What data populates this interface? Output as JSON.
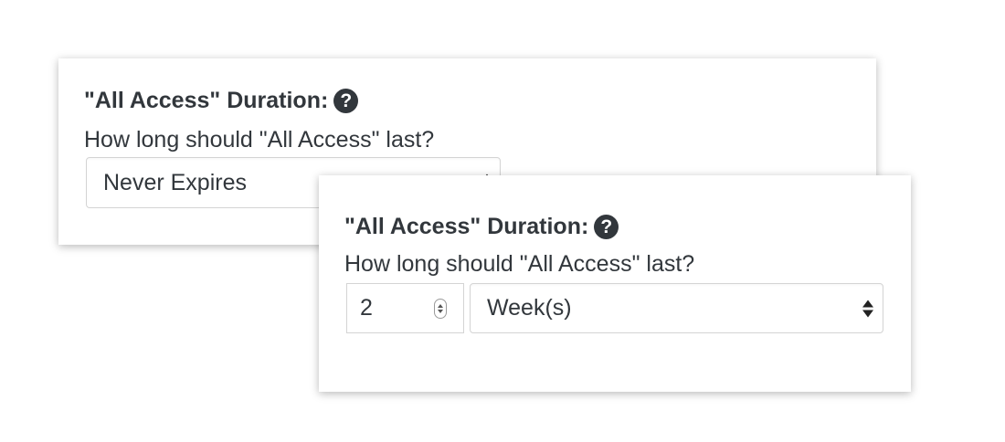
{
  "panel_back": {
    "title": "\"All Access\" Duration:",
    "help_icon": "question-circle",
    "question": "How long should \"All Access\" last?",
    "duration_select": {
      "selected": "Never Expires"
    }
  },
  "panel_front": {
    "title": "\"All Access\" Duration:",
    "help_icon": "question-circle",
    "question": "How long should \"All Access\" last?",
    "duration_number": {
      "value": "2"
    },
    "unit_select": {
      "selected": "Week(s)"
    }
  },
  "help_icon_glyph": "?",
  "colors": {
    "text": "#32373c",
    "border": "#d4d4d4",
    "background": "#ffffff"
  }
}
